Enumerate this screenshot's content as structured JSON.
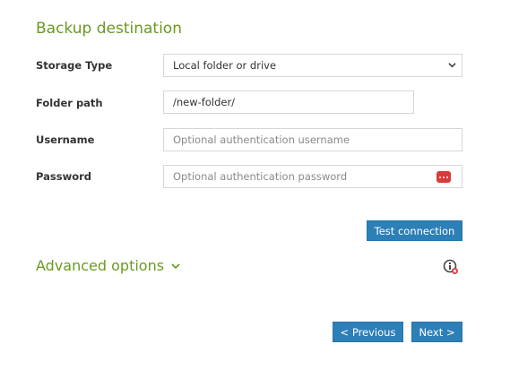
{
  "section": {
    "title": "Backup destination"
  },
  "form": {
    "storage_type": {
      "label": "Storage Type",
      "value": "Local folder or drive"
    },
    "folder_path": {
      "label": "Folder path",
      "value": "/new-folder/"
    },
    "username": {
      "label": "Username",
      "placeholder": "Optional authentication username"
    },
    "password": {
      "label": "Password",
      "placeholder": "Optional authentication password"
    }
  },
  "buttons": {
    "test_connection": "Test connection",
    "previous": "< Previous",
    "next": "Next >"
  },
  "advanced": {
    "label": "Advanced options"
  },
  "colors": {
    "accent_green": "#6a9a1f",
    "button_blue": "#2d7fb8",
    "password_icon_red": "#d93b3b"
  }
}
